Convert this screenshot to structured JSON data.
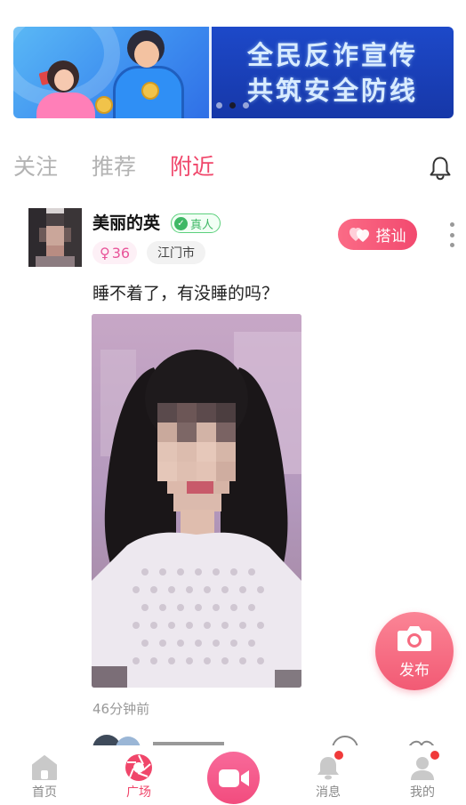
{
  "banner": {
    "line1": "全民反诈宣传",
    "line2": "共筑安全防线",
    "dots": 3,
    "active_dot": 1
  },
  "tabs": [
    {
      "label": "关注",
      "active": false
    },
    {
      "label": "推荐",
      "active": false
    },
    {
      "label": "附近",
      "active": true
    }
  ],
  "post": {
    "username": "美丽的英",
    "verified_label": "真人",
    "age": "36",
    "gender_symbol": "♀",
    "location": "江门市",
    "greet_label": "搭讪",
    "text": "睡不着了，有没睡的吗？",
    "time": "46分钟前"
  },
  "publish": {
    "label": "发布"
  },
  "nav": [
    {
      "label": "首页",
      "active": false
    },
    {
      "label": "广场",
      "active": true
    },
    {
      "label": "",
      "active": false
    },
    {
      "label": "消息",
      "active": false
    },
    {
      "label": "我的",
      "active": false
    }
  ],
  "colors": {
    "accent": "#f0466a",
    "verified": "#3fb866",
    "banner_blue": "#1d49c9"
  }
}
